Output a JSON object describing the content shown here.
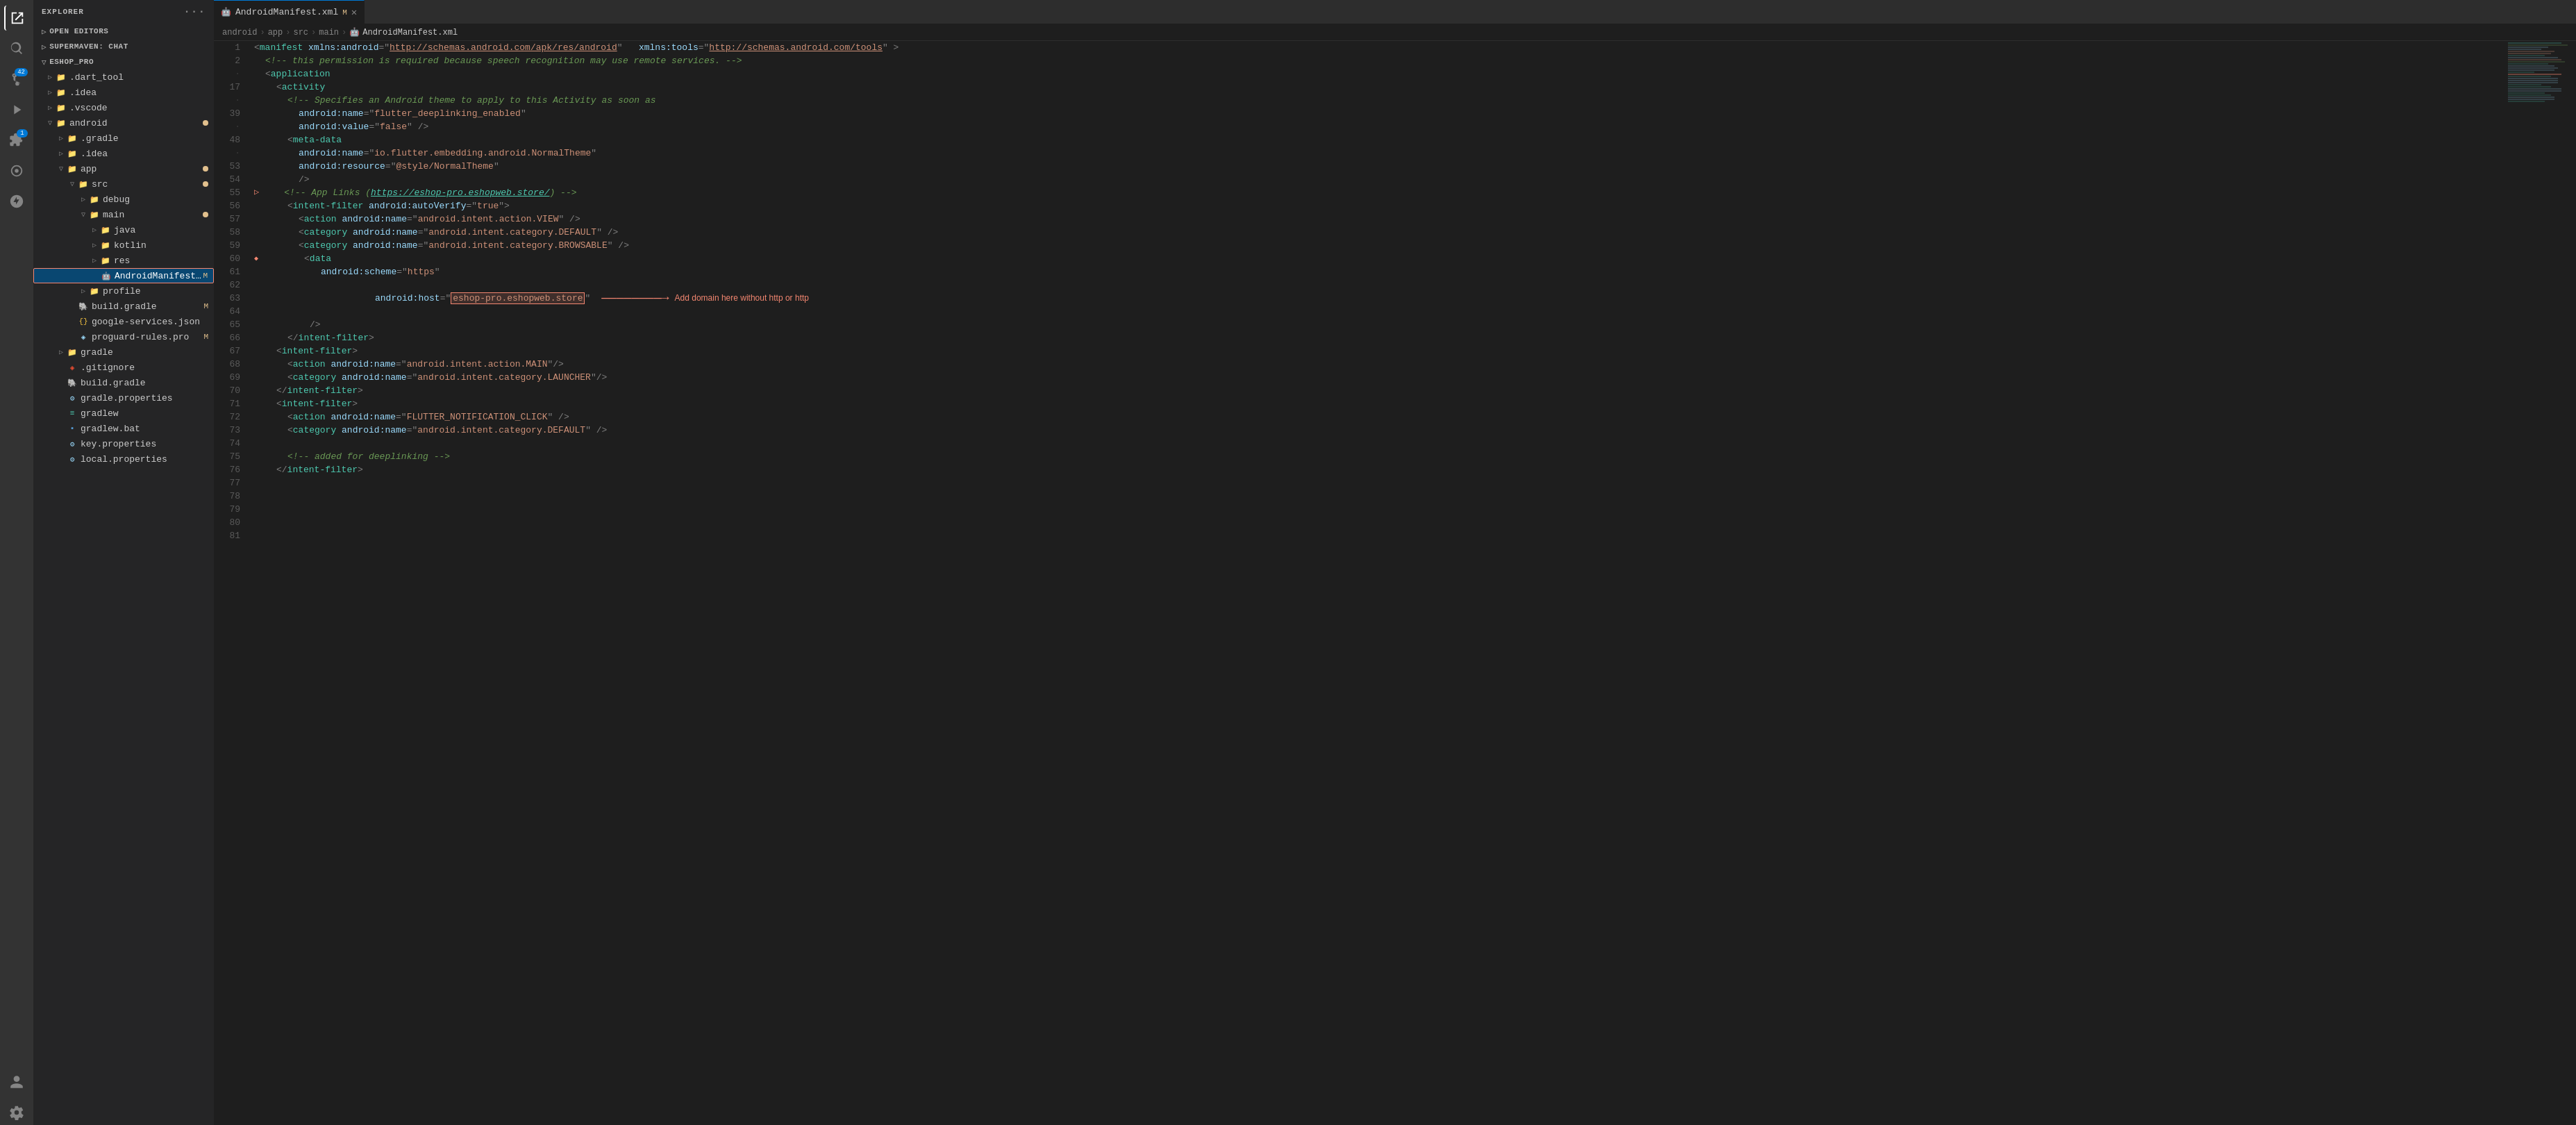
{
  "activityBar": {
    "icons": [
      {
        "name": "explorer-icon",
        "symbol": "⎘",
        "active": true,
        "badge": null
      },
      {
        "name": "search-icon",
        "symbol": "🔍",
        "active": false,
        "badge": null
      },
      {
        "name": "source-control-icon",
        "symbol": "⎇",
        "active": false,
        "badge": "42"
      },
      {
        "name": "run-icon",
        "symbol": "▷",
        "active": false,
        "badge": null
      },
      {
        "name": "extensions-icon",
        "symbol": "⧉",
        "active": false,
        "badge": "1"
      },
      {
        "name": "supermaven-icon",
        "symbol": "◈",
        "active": false,
        "badge": null
      },
      {
        "name": "search2-icon",
        "symbol": "⌕",
        "active": false,
        "badge": null
      },
      {
        "name": "settings-icon",
        "symbol": "⚙",
        "active": false,
        "badge": null
      }
    ]
  },
  "sidebar": {
    "title": "EXPLORER",
    "sections": {
      "openEditors": "OPEN EDITORS",
      "supermavenChat": "SUPERMAVEN: CHAT",
      "project": "ESHOP_PRO"
    },
    "tree": [
      {
        "id": "dart_tool",
        "label": ".dart_tool",
        "indent": 1,
        "type": "folder",
        "collapsed": true
      },
      {
        "id": "idea",
        "label": ".idea",
        "indent": 1,
        "type": "folder",
        "collapsed": true
      },
      {
        "id": "vscode",
        "label": ".vscode",
        "indent": 1,
        "type": "folder",
        "collapsed": true
      },
      {
        "id": "android",
        "label": "android",
        "indent": 1,
        "type": "folder",
        "collapsed": false,
        "modified": true
      },
      {
        "id": "gradle_android",
        "label": ".gradle",
        "indent": 2,
        "type": "folder",
        "collapsed": true
      },
      {
        "id": "idea_android",
        "label": ".idea",
        "indent": 2,
        "type": "folder",
        "collapsed": true
      },
      {
        "id": "app",
        "label": "app",
        "indent": 2,
        "type": "folder",
        "collapsed": false,
        "modified": true
      },
      {
        "id": "src",
        "label": "src",
        "indent": 3,
        "type": "folder",
        "collapsed": false,
        "modified": true
      },
      {
        "id": "debug",
        "label": "debug",
        "indent": 4,
        "type": "folder",
        "collapsed": true
      },
      {
        "id": "main",
        "label": "main",
        "indent": 4,
        "type": "folder",
        "collapsed": false,
        "modified": true
      },
      {
        "id": "java",
        "label": "java",
        "indent": 5,
        "type": "folder",
        "collapsed": true
      },
      {
        "id": "kotlin",
        "label": "kotlin",
        "indent": 5,
        "type": "folder",
        "collapsed": true
      },
      {
        "id": "res",
        "label": "res",
        "indent": 5,
        "type": "folder",
        "collapsed": true
      },
      {
        "id": "AndroidManifest",
        "label": "AndroidManifest.xml",
        "indent": 5,
        "type": "file-xml",
        "selected": true,
        "modified_m": true
      },
      {
        "id": "profile",
        "label": "profile",
        "indent": 4,
        "type": "folder",
        "collapsed": true
      },
      {
        "id": "build_gradle_app",
        "label": "build.gradle",
        "indent": 3,
        "type": "file-gradle",
        "modified_m": true
      },
      {
        "id": "google_services",
        "label": "google-services.json",
        "indent": 3,
        "type": "file-json"
      },
      {
        "id": "proguard",
        "label": "proguard-rules.pro",
        "indent": 3,
        "type": "file-pro",
        "modified_m": true
      },
      {
        "id": "gradle_folder",
        "label": "gradle",
        "indent": 2,
        "type": "folder",
        "collapsed": true
      },
      {
        "id": "gitignore",
        "label": ".gitignore",
        "indent": 2,
        "type": "file-git"
      },
      {
        "id": "build_gradle_root",
        "label": "build.gradle",
        "indent": 2,
        "type": "file-gradle"
      },
      {
        "id": "gradle_properties",
        "label": "gradle.properties",
        "indent": 2,
        "type": "file-properties"
      },
      {
        "id": "gradlew",
        "label": "gradlew",
        "indent": 2,
        "type": "file-gradlew"
      },
      {
        "id": "gradlew_bat",
        "label": "gradlew.bat",
        "indent": 2,
        "type": "file-bat"
      },
      {
        "id": "key_properties",
        "label": "key.properties",
        "indent": 2,
        "type": "file-properties"
      },
      {
        "id": "local_properties",
        "label": "local.properties",
        "indent": 2,
        "type": "file-properties"
      }
    ]
  },
  "editor": {
    "tab": {
      "icon": "🤖",
      "filename": "AndroidManifest.xml",
      "modified": true
    },
    "breadcrumb": {
      "parts": [
        "android",
        "app",
        "src",
        "main",
        "AndroidManifest.xml"
      ]
    },
    "lines": [
      {
        "num": 1,
        "content": "manifest",
        "type": "manifest"
      },
      {
        "num": 2,
        "content": "comment",
        "text": "<!-- this permission is required because speech recognition may use remote services. -->"
      },
      {
        "num": 17,
        "content": "application"
      },
      {
        "num": 39,
        "content": "activity"
      },
      {
        "num": 48,
        "content": "comment2",
        "text": "<!-- Specifies an Android theme to apply to this Activity as soon as"
      },
      {
        "num": 53,
        "content": "attr1",
        "text": "android:name=\"flutter_deeplinking_enabled\""
      },
      {
        "num": 54,
        "content": "attr2",
        "text": "android:value=\"false\" />"
      },
      {
        "num": 55,
        "content": "meta",
        "text": "<meta-data"
      },
      {
        "num": 56,
        "content": "attr3",
        "text": "android:name=\"io.flutter.embedding.android.NormalTheme\""
      },
      {
        "num": 57,
        "content": "attr4",
        "text": "android:resource=\"@style/NormalTheme\""
      },
      {
        "num": 58,
        "content": "close1",
        "text": "/>"
      },
      {
        "num": 59,
        "content": "comment3",
        "text": "<!-- App Links (https://eshop-pro.eshopweb.store/) -->"
      },
      {
        "num": 60,
        "content": "intent1",
        "text": "<intent-filter android:autoVerify=\"true\">"
      },
      {
        "num": 61,
        "content": "action1",
        "text": "<action android:name=\"android.intent.action.VIEW\" />"
      },
      {
        "num": 62,
        "content": "category1",
        "text": "<category android:name=\"android.intent.category.DEFAULT\" />"
      },
      {
        "num": 63,
        "content": "category2",
        "text": "<category android:name=\"android.intent.category.BROWSABLE\" />"
      },
      {
        "num": 64,
        "content": "data_open",
        "text": "<data"
      },
      {
        "num": 65,
        "content": "scheme",
        "text": "android:scheme=\"https\""
      },
      {
        "num": 66,
        "content": "host",
        "text": "android:host=\"eshop-pro.eshopweb.store\"",
        "annotation": true
      },
      {
        "num": 67,
        "content": "close2",
        "text": "/>"
      },
      {
        "num": 68,
        "content": "close_intent",
        "text": "</intent-filter>"
      },
      {
        "num": 69,
        "content": "intent2",
        "text": "<intent-filter>"
      },
      {
        "num": 70,
        "content": "action2",
        "text": "<action android:name=\"android.intent.action.MAIN\"/>"
      },
      {
        "num": 71,
        "content": "category3",
        "text": "<category android:name=\"android.intent.category.LAUNCHER\"/>"
      },
      {
        "num": 72,
        "content": "close_intent2",
        "text": "</intent-filter>"
      },
      {
        "num": 73,
        "content": "intent3",
        "text": "<intent-filter>"
      },
      {
        "num": 74,
        "content": "action3",
        "text": "<action android:name=\"FLUTTER_NOTIFICATION_CLICK\" />"
      },
      {
        "num": 75,
        "content": "category4",
        "text": "<category android:name=\"android.intent.category.DEFAULT\" />"
      },
      {
        "num": 76,
        "content": "empty",
        "text": ""
      },
      {
        "num": 77,
        "content": "comment4",
        "text": "<!-- added for deeplinking -->"
      },
      {
        "num": 78,
        "content": "close_intent3",
        "text": "</intent-filter>"
      },
      {
        "num": 79,
        "content": "empty2",
        "text": ""
      },
      {
        "num": 80,
        "content": "empty3",
        "text": ""
      },
      {
        "num": 81,
        "content": "empty4",
        "text": ""
      }
    ],
    "annotation": {
      "text": "Add domain here without http or http",
      "arrowColor": "#f48771"
    }
  }
}
